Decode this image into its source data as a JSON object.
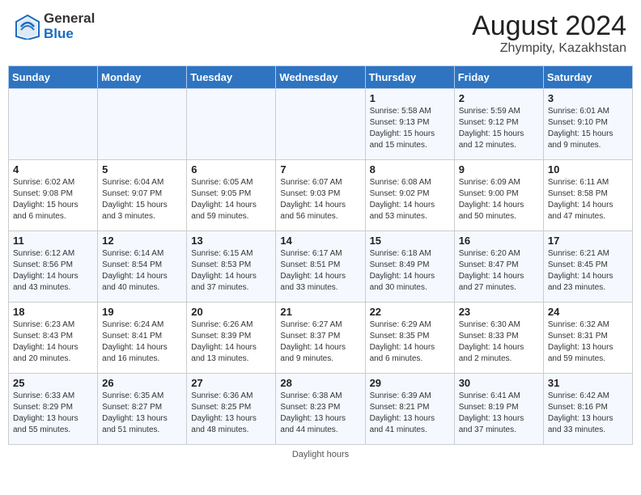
{
  "header": {
    "logo_general": "General",
    "logo_blue": "Blue",
    "month_year": "August 2024",
    "location": "Zhympity, Kazakhstan"
  },
  "footer": {
    "note": "Daylight hours"
  },
  "weekdays": [
    "Sunday",
    "Monday",
    "Tuesday",
    "Wednesday",
    "Thursday",
    "Friday",
    "Saturday"
  ],
  "weeks": [
    [
      {
        "day": "",
        "sunrise": "",
        "sunset": "",
        "daylight": ""
      },
      {
        "day": "",
        "sunrise": "",
        "sunset": "",
        "daylight": ""
      },
      {
        "day": "",
        "sunrise": "",
        "sunset": "",
        "daylight": ""
      },
      {
        "day": "",
        "sunrise": "",
        "sunset": "",
        "daylight": ""
      },
      {
        "day": "1",
        "sunrise": "Sunrise: 5:58 AM",
        "sunset": "Sunset: 9:13 PM",
        "daylight": "Daylight: 15 hours and 15 minutes."
      },
      {
        "day": "2",
        "sunrise": "Sunrise: 5:59 AM",
        "sunset": "Sunset: 9:12 PM",
        "daylight": "Daylight: 15 hours and 12 minutes."
      },
      {
        "day": "3",
        "sunrise": "Sunrise: 6:01 AM",
        "sunset": "Sunset: 9:10 PM",
        "daylight": "Daylight: 15 hours and 9 minutes."
      }
    ],
    [
      {
        "day": "4",
        "sunrise": "Sunrise: 6:02 AM",
        "sunset": "Sunset: 9:08 PM",
        "daylight": "Daylight: 15 hours and 6 minutes."
      },
      {
        "day": "5",
        "sunrise": "Sunrise: 6:04 AM",
        "sunset": "Sunset: 9:07 PM",
        "daylight": "Daylight: 15 hours and 3 minutes."
      },
      {
        "day": "6",
        "sunrise": "Sunrise: 6:05 AM",
        "sunset": "Sunset: 9:05 PM",
        "daylight": "Daylight: 14 hours and 59 minutes."
      },
      {
        "day": "7",
        "sunrise": "Sunrise: 6:07 AM",
        "sunset": "Sunset: 9:03 PM",
        "daylight": "Daylight: 14 hours and 56 minutes."
      },
      {
        "day": "8",
        "sunrise": "Sunrise: 6:08 AM",
        "sunset": "Sunset: 9:02 PM",
        "daylight": "Daylight: 14 hours and 53 minutes."
      },
      {
        "day": "9",
        "sunrise": "Sunrise: 6:09 AM",
        "sunset": "Sunset: 9:00 PM",
        "daylight": "Daylight: 14 hours and 50 minutes."
      },
      {
        "day": "10",
        "sunrise": "Sunrise: 6:11 AM",
        "sunset": "Sunset: 8:58 PM",
        "daylight": "Daylight: 14 hours and 47 minutes."
      }
    ],
    [
      {
        "day": "11",
        "sunrise": "Sunrise: 6:12 AM",
        "sunset": "Sunset: 8:56 PM",
        "daylight": "Daylight: 14 hours and 43 minutes."
      },
      {
        "day": "12",
        "sunrise": "Sunrise: 6:14 AM",
        "sunset": "Sunset: 8:54 PM",
        "daylight": "Daylight: 14 hours and 40 minutes."
      },
      {
        "day": "13",
        "sunrise": "Sunrise: 6:15 AM",
        "sunset": "Sunset: 8:53 PM",
        "daylight": "Daylight: 14 hours and 37 minutes."
      },
      {
        "day": "14",
        "sunrise": "Sunrise: 6:17 AM",
        "sunset": "Sunset: 8:51 PM",
        "daylight": "Daylight: 14 hours and 33 minutes."
      },
      {
        "day": "15",
        "sunrise": "Sunrise: 6:18 AM",
        "sunset": "Sunset: 8:49 PM",
        "daylight": "Daylight: 14 hours and 30 minutes."
      },
      {
        "day": "16",
        "sunrise": "Sunrise: 6:20 AM",
        "sunset": "Sunset: 8:47 PM",
        "daylight": "Daylight: 14 hours and 27 minutes."
      },
      {
        "day": "17",
        "sunrise": "Sunrise: 6:21 AM",
        "sunset": "Sunset: 8:45 PM",
        "daylight": "Daylight: 14 hours and 23 minutes."
      }
    ],
    [
      {
        "day": "18",
        "sunrise": "Sunrise: 6:23 AM",
        "sunset": "Sunset: 8:43 PM",
        "daylight": "Daylight: 14 hours and 20 minutes."
      },
      {
        "day": "19",
        "sunrise": "Sunrise: 6:24 AM",
        "sunset": "Sunset: 8:41 PM",
        "daylight": "Daylight: 14 hours and 16 minutes."
      },
      {
        "day": "20",
        "sunrise": "Sunrise: 6:26 AM",
        "sunset": "Sunset: 8:39 PM",
        "daylight": "Daylight: 14 hours and 13 minutes."
      },
      {
        "day": "21",
        "sunrise": "Sunrise: 6:27 AM",
        "sunset": "Sunset: 8:37 PM",
        "daylight": "Daylight: 14 hours and 9 minutes."
      },
      {
        "day": "22",
        "sunrise": "Sunrise: 6:29 AM",
        "sunset": "Sunset: 8:35 PM",
        "daylight": "Daylight: 14 hours and 6 minutes."
      },
      {
        "day": "23",
        "sunrise": "Sunrise: 6:30 AM",
        "sunset": "Sunset: 8:33 PM",
        "daylight": "Daylight: 14 hours and 2 minutes."
      },
      {
        "day": "24",
        "sunrise": "Sunrise: 6:32 AM",
        "sunset": "Sunset: 8:31 PM",
        "daylight": "Daylight: 13 hours and 59 minutes."
      }
    ],
    [
      {
        "day": "25",
        "sunrise": "Sunrise: 6:33 AM",
        "sunset": "Sunset: 8:29 PM",
        "daylight": "Daylight: 13 hours and 55 minutes."
      },
      {
        "day": "26",
        "sunrise": "Sunrise: 6:35 AM",
        "sunset": "Sunset: 8:27 PM",
        "daylight": "Daylight: 13 hours and 51 minutes."
      },
      {
        "day": "27",
        "sunrise": "Sunrise: 6:36 AM",
        "sunset": "Sunset: 8:25 PM",
        "daylight": "Daylight: 13 hours and 48 minutes."
      },
      {
        "day": "28",
        "sunrise": "Sunrise: 6:38 AM",
        "sunset": "Sunset: 8:23 PM",
        "daylight": "Daylight: 13 hours and 44 minutes."
      },
      {
        "day": "29",
        "sunrise": "Sunrise: 6:39 AM",
        "sunset": "Sunset: 8:21 PM",
        "daylight": "Daylight: 13 hours and 41 minutes."
      },
      {
        "day": "30",
        "sunrise": "Sunrise: 6:41 AM",
        "sunset": "Sunset: 8:19 PM",
        "daylight": "Daylight: 13 hours and 37 minutes."
      },
      {
        "day": "31",
        "sunrise": "Sunrise: 6:42 AM",
        "sunset": "Sunset: 8:16 PM",
        "daylight": "Daylight: 13 hours and 33 minutes."
      }
    ]
  ]
}
